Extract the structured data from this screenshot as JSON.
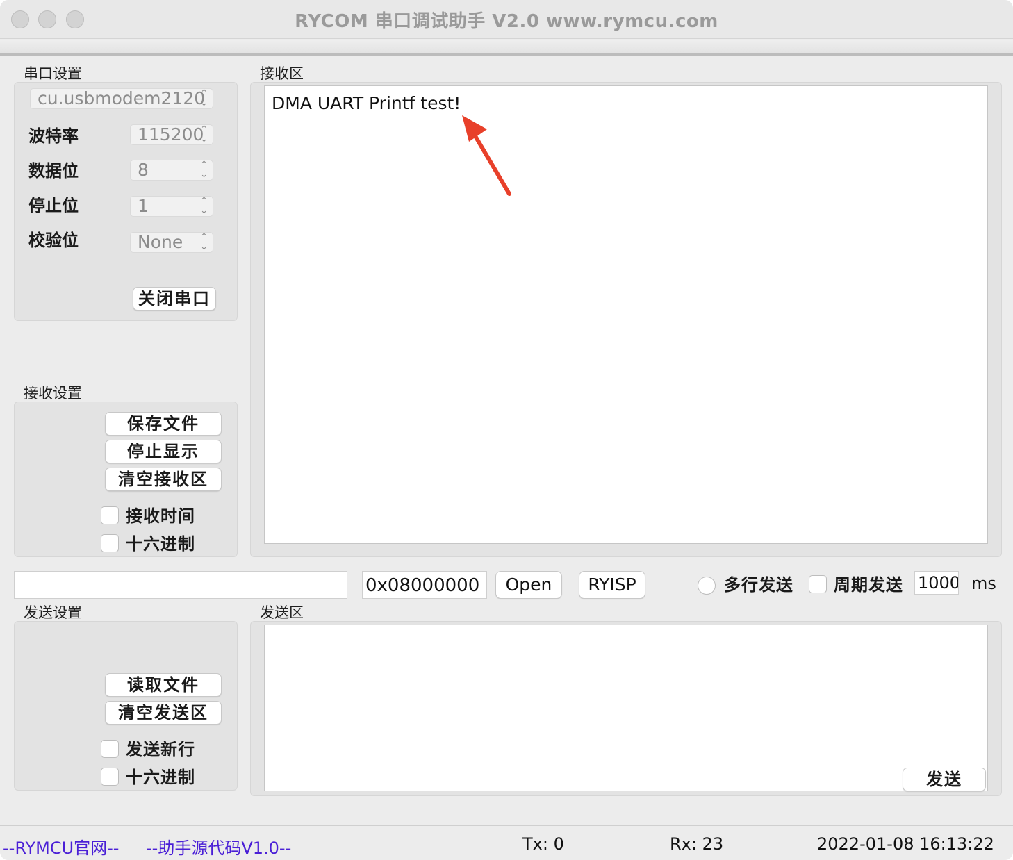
{
  "window": {
    "title": "RYCOM 串口调试助手 V2.0 www.rymcu.com"
  },
  "serial_settings": {
    "group_label": "串口设置",
    "port": "cu.usbmodem2120",
    "baud_label": "波特率",
    "baud_value": "115200",
    "data_bits_label": "数据位",
    "data_bits_value": "8",
    "stop_bits_label": "停止位",
    "stop_bits_value": "1",
    "parity_label": "校验位",
    "parity_value": "None",
    "close_port_button": "关闭串口"
  },
  "receive_settings": {
    "group_label": "接收设置",
    "save_file_button": "保存文件",
    "stop_display_button": "停止显示",
    "clear_receive_button": "清空接收区",
    "receive_time_label": "接收时间",
    "hex_label": "十六进制"
  },
  "receive_area": {
    "group_label": "接收区",
    "content": "DMA UART Printf test!"
  },
  "flash_row": {
    "file_path": "",
    "address": "0x08000000",
    "open_button": "Open",
    "ryisp_button": "RYISP",
    "multiline_label": "多行发送",
    "periodic_label": "周期发送",
    "period_value": "1000",
    "period_unit": "ms"
  },
  "send_settings": {
    "group_label": "发送设置",
    "read_file_button": "读取文件",
    "clear_send_button": "清空发送区",
    "send_newline_label": "发送新行",
    "hex_label": "十六进制"
  },
  "send_area": {
    "group_label": "发送区",
    "content": "",
    "send_button": "发送"
  },
  "status_bar": {
    "website_link": "--RYMCU官网--",
    "source_link": "--助手源代码V1.0--",
    "tx": "Tx: 0",
    "rx": "Rx: 23",
    "datetime": "2022-01-08 16:13:22"
  },
  "colors": {
    "link": "#4a1fd6",
    "annotation_arrow": "#e8402a"
  }
}
